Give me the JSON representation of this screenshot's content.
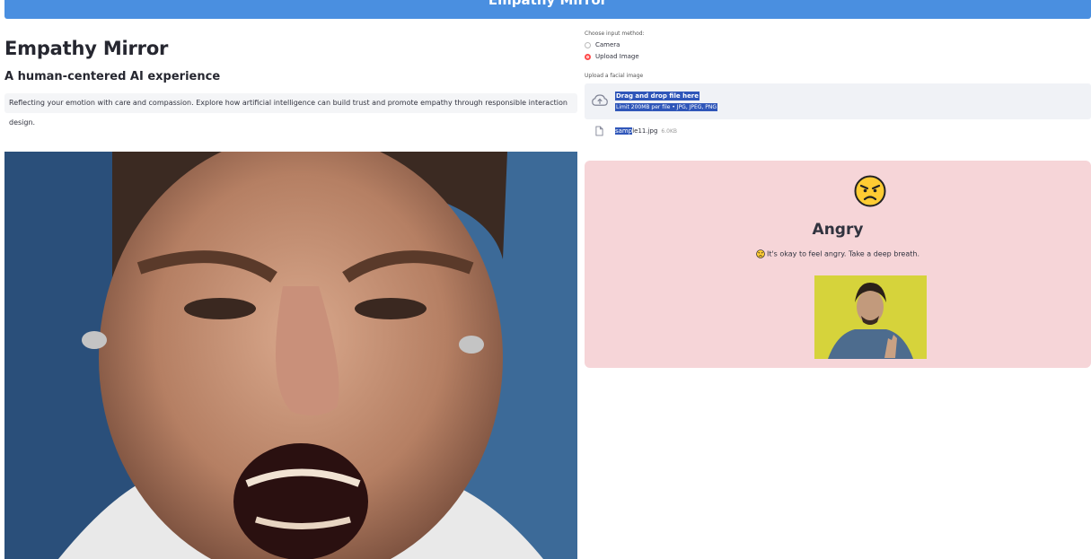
{
  "banner": {
    "title": "Empathy Mirror"
  },
  "main": {
    "title": "Empathy Mirror",
    "subtitle": "A human-centered AI experience",
    "info": "Reflecting your emotion with care and compassion. Explore how artificial intelligence can build trust and promote empathy through responsible interaction design."
  },
  "input_method": {
    "label": "Choose input method:",
    "options": [
      "Camera",
      "Upload Image"
    ],
    "selected": "Upload Image"
  },
  "uploader": {
    "label": "Upload a facial image",
    "drop_text": "Drag and drop file here",
    "limit_text": "Limit 200MB per file • JPG, JPEG, PNG",
    "icon": "cloud-upload-icon"
  },
  "uploaded_file": {
    "name_highlight": "samp",
    "name_rest": "le11.jpg",
    "size": "6.0KB",
    "icon": "file-icon"
  },
  "result": {
    "emotion": "Angry",
    "message": "It's okay to feel angry. Take a deep breath.",
    "emoji": "angry-face-icon",
    "card_color": "#f6d5d8"
  },
  "colors": {
    "banner": "#4a8fe0",
    "radio_selected": "#ff4b4b",
    "selection": "#2f56b9"
  }
}
